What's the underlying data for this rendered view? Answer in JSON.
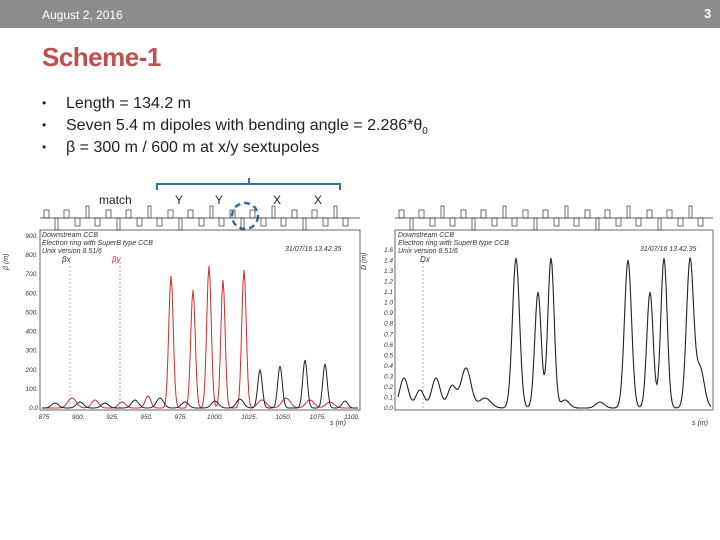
{
  "header": {
    "date": "August 2, 2016",
    "page_number": "3"
  },
  "title": "Scheme-1",
  "bullets": [
    {
      "text": "Length = 134.2 m",
      "sub": ""
    },
    {
      "text": "Seven 5.4 m dipoles with bending angle = 2.286*θ",
      "sub": "0"
    },
    {
      "text": "β = 300 m / 600 m at x/y sextupoles",
      "sub": ""
    }
  ],
  "labels": {
    "match": "match",
    "y1": "Y",
    "y2": "Y",
    "x1": "X",
    "x2": "X"
  },
  "left_plot": {
    "legend_line1": "Downstream CCB",
    "legend_line2": "Electron ring with SuperB type CCB",
    "legend_line3": "Unix version 8.51/6",
    "timestamp": "31/07/16  13.42.35",
    "beta_x_label": "βx",
    "beta_y_label": "βy",
    "yticks": [
      "900.",
      "800.",
      "700.",
      "600.",
      "500.",
      "400.",
      "300.",
      "200.",
      "100.",
      "0.0"
    ],
    "xticks": [
      "875",
      "900.",
      "925.",
      "950.",
      "975.",
      "1000.",
      "1025.",
      "1050.",
      "1075.",
      "1100."
    ],
    "xlabel": "s (m)",
    "ylabel": "β (m)"
  },
  "right_plot": {
    "legend_line1": "Downstream CCB",
    "legend_line2": "Electron ring with SuperB type CCB",
    "legend_line3": "Unix version 8.51/6",
    "timestamp": "31/07/16  13.42.35",
    "dx_label": "Dx",
    "yticks": [
      "1.6",
      "1.4",
      "1.3",
      "1.2",
      "1.1",
      "1.0",
      "0.9",
      "0.8",
      "0.7",
      "0.6",
      "0.5",
      "0.4",
      "0.3",
      "0.2",
      "0.1",
      "0.0"
    ],
    "xlabel": "s (m)",
    "ylabel": "D (m)"
  },
  "colors": {
    "title": "#c0504d",
    "topbar": "#8c8c8c",
    "beta_y": "#d42a2a",
    "beta_x": "#222222",
    "marker": "#2f6fb0"
  }
}
